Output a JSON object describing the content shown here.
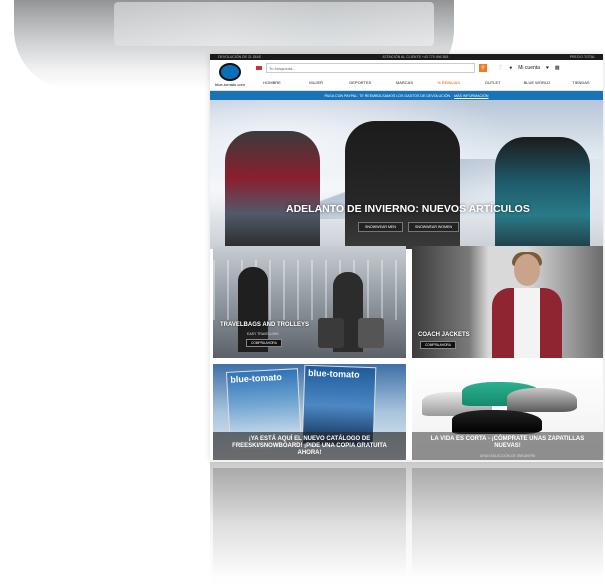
{
  "site": {
    "topbar": {
      "left": "DEVOLUCIÓN DE 21 DÍAS",
      "center": "ATENCIÓN AL CLIENTE +43 775 496 365",
      "right": "PRECIO TOTAL"
    },
    "logo_text": "blue-tomato.com",
    "search": {
      "placeholder": "Tu búsqueda..."
    },
    "account_label": "Mi cuenta",
    "nav": [
      "HOMBRE",
      "MUJER",
      "DEPORTES",
      "MARCAS",
      "% REBAJAS",
      "OUTLET",
      "BLUE WORLD",
      "TIENDAS"
    ],
    "promo": {
      "text": "PAGA CON PAYPAL: TE REEMBOLSAMOS LOS GASTOS DE DEVOLUCIÓN.",
      "link": "MÁS INFORMACIÓN"
    },
    "hero": {
      "title": "ADELANTO DE INVIERNO: NUEVOS ARTÍCULOS",
      "buttons": [
        "SNOWWEAR MEN",
        "SNOWWEAR WOMEN"
      ]
    },
    "tiles": {
      "travel": {
        "title": "TRAVELBAGS AND TROLLEYS",
        "sub": "EASY TRAVELLING",
        "button": "COMPRA AHORA"
      },
      "coach": {
        "title": "COACH JACKETS",
        "button": "COMPRA AHORA"
      },
      "catalog": {
        "title": "¡YA ESTÁ AQUÍ EL NUEVO CATÁLOGO DE FREESKI/SNOWBOARD! ¡PIDE UNA COPIA GRATUITA AHORA!",
        "mag_title": "blue-tomato"
      },
      "sneakers": {
        "title": "LA VIDA ES CORTA - ¡CÓMPRATE UNAS ZAPATILLAS NUEVAS!",
        "sub": "GRAN SELECCIÓN DE SNEAKERS"
      }
    }
  }
}
